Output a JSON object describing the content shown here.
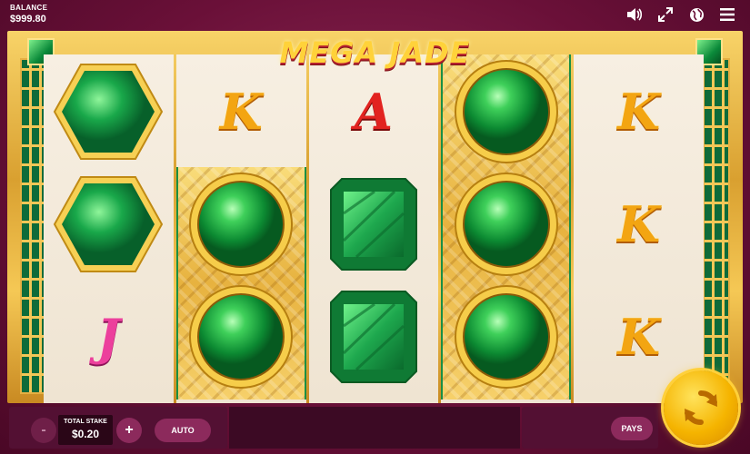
{
  "header": {
    "balance_label": "BALANCE",
    "balance_value": "$999.80",
    "icons": [
      "volume-icon",
      "fullscreen-icon",
      "globe-icon",
      "menu-icon"
    ]
  },
  "game": {
    "logo_text": "MEGA JADE",
    "reels": [
      [
        "hexagon-jade",
        "hexagon-jade",
        "J"
      ],
      [
        "K",
        "round-jade",
        "round-jade"
      ],
      [
        "A",
        "square-emerald",
        "square-emerald"
      ],
      [
        "round-jade",
        "round-jade",
        "round-jade"
      ],
      [
        "K",
        "K",
        "K"
      ]
    ]
  },
  "controls": {
    "minus": "-",
    "total_stake_label": "TOTAL STAKE",
    "total_stake_value": "$0.20",
    "plus": "+",
    "auto_label": "AUTO",
    "pays_label": "PAYS"
  },
  "colors": {
    "background": "#6a1038",
    "gold": "#f3c757",
    "jade": "#0e8a3a",
    "spin": "#f5b400"
  }
}
